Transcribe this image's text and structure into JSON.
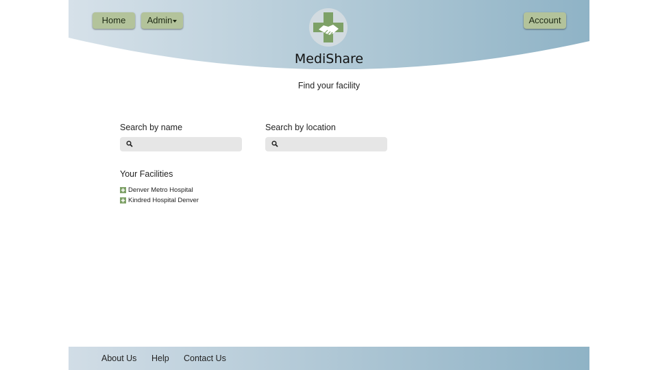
{
  "app": {
    "name": "MediShare",
    "tagline": "Find your facility"
  },
  "nav": {
    "home_label": "Home",
    "admin_label": "Admin",
    "account_label": "Account"
  },
  "search": {
    "name_label": "Search by name",
    "name_placeholder": "",
    "location_label": "Search by location",
    "location_placeholder": ""
  },
  "facilities": {
    "title": "Your Facilities",
    "items": [
      {
        "label": "Denver Metro Hospital"
      },
      {
        "label": "Kindred Hospital Denver"
      }
    ]
  },
  "footer": {
    "about_label": "About Us",
    "help_label": "Help",
    "contact_label": "Contact Us"
  },
  "colors": {
    "button_bg": "#b3c39b",
    "cross_green": "#7ea167",
    "header_gradient_start": "#d6e1e9",
    "header_gradient_end": "#8fb3c6",
    "search_bg": "#e6e6e6"
  },
  "icons": {
    "logo": "medical-cross-handshake-icon",
    "dropdown": "caret-down-icon",
    "search": "magnifier-icon",
    "facility": "plus-square-icon"
  }
}
